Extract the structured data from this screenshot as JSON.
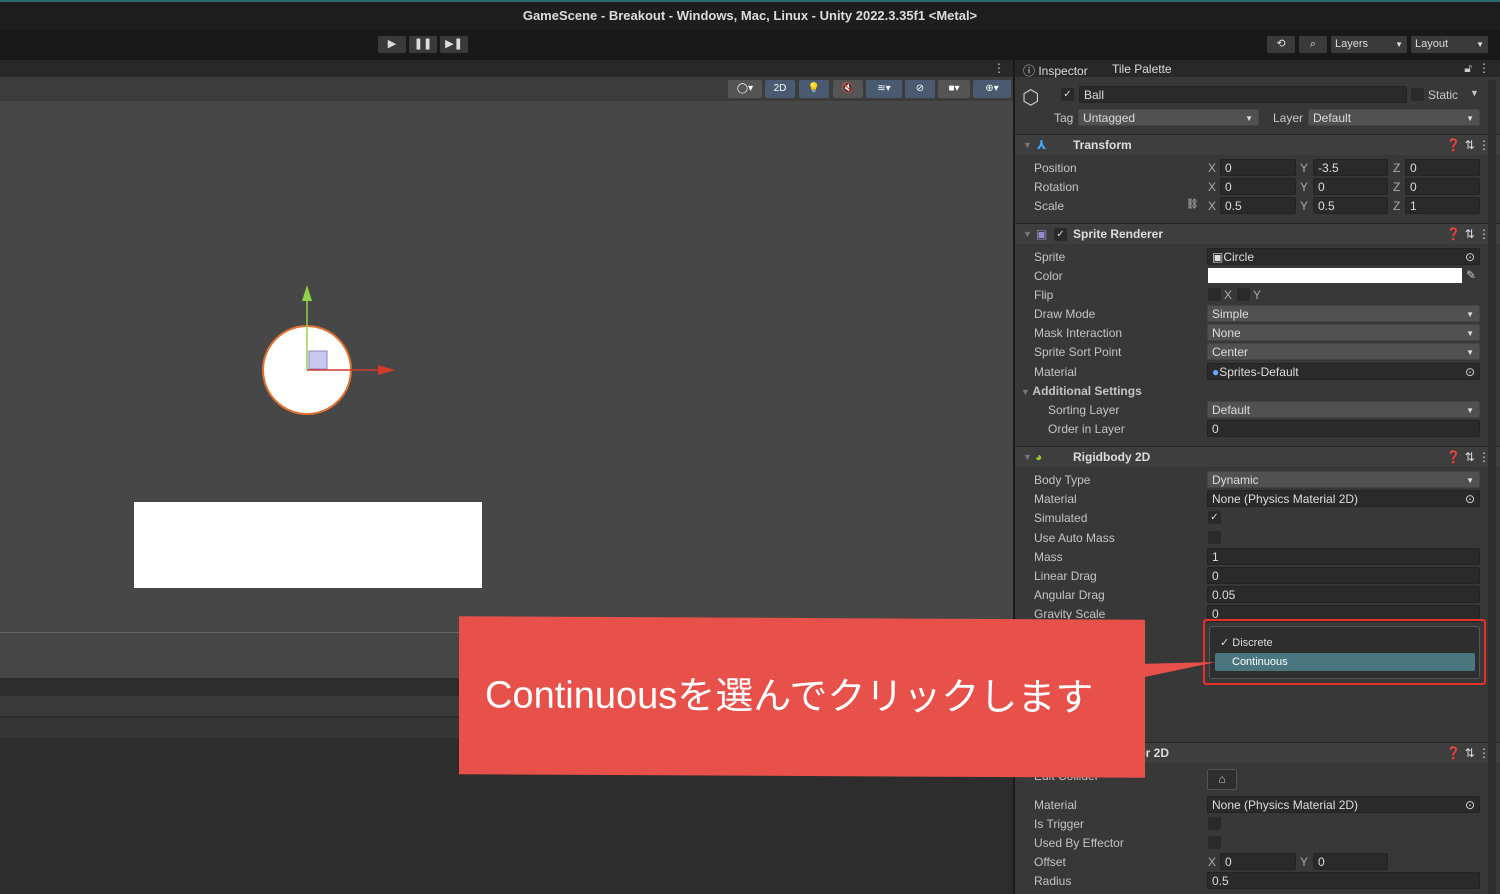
{
  "window": {
    "title": "GameScene - Breakout - Windows, Mac, Linux - Unity 2022.3.35f1 <Metal>"
  },
  "toolbar": {
    "play": "▶",
    "pause": "❚❚",
    "step": "▶❚",
    "layers": "Layers",
    "layout": "Layout"
  },
  "scene_tools": {
    "mode_2d": "2D"
  },
  "inspector": {
    "tabs": [
      "Inspector",
      "Tile Palette"
    ],
    "object_name": "Ball",
    "static_label": "Static",
    "tag_label": "Tag",
    "tag_value": "Untagged",
    "layer_label": "Layer",
    "layer_value": "Default",
    "transform": {
      "title": "Transform",
      "position": {
        "label": "Position",
        "x": "0",
        "y": "-3.5",
        "z": "0"
      },
      "rotation": {
        "label": "Rotation",
        "x": "0",
        "y": "0",
        "z": "0"
      },
      "scale": {
        "label": "Scale",
        "x": "0.5",
        "y": "0.5",
        "z": "1"
      }
    },
    "sprite_renderer": {
      "title": "Sprite Renderer",
      "rows": [
        {
          "label": "Sprite",
          "value": "Circle"
        },
        {
          "label": "Color",
          "value": ""
        },
        {
          "label": "Flip",
          "value": ""
        },
        {
          "label": "Draw Mode",
          "value": "Simple"
        },
        {
          "label": "Mask Interaction",
          "value": "None"
        },
        {
          "label": "Sprite Sort Point",
          "value": "Center"
        },
        {
          "label": "Material",
          "value": "Sprites-Default"
        }
      ],
      "additional_settings": "Additional Settings",
      "sorting_layer": {
        "label": "Sorting Layer",
        "value": "Default"
      },
      "order_in_layer": {
        "label": "Order in Layer",
        "value": "0"
      },
      "flip_x": "X",
      "flip_y": "Y"
    },
    "rigidbody": {
      "title": "Rigidbody 2D",
      "rows": [
        {
          "label": "Body Type",
          "value": "Dynamic"
        },
        {
          "label": "Material",
          "value": "None (Physics Material 2D)"
        },
        {
          "label": "Simulated",
          "value": "✓"
        },
        {
          "label": "Use Auto Mass",
          "value": ""
        },
        {
          "label": "Mass",
          "value": "1"
        },
        {
          "label": "Linear Drag",
          "value": "0"
        },
        {
          "label": "Angular Drag",
          "value": "0.05"
        },
        {
          "label": "Gravity Scale",
          "value": "0"
        }
      ]
    },
    "dropdown": {
      "options": [
        "✓ Discrete",
        "Continuous"
      ],
      "highlighted": "Continuous"
    },
    "collider": {
      "title_partial": "er 2D",
      "edit_label": "Edit Collider",
      "rows": [
        {
          "label": "Material",
          "value": "None (Physics Material 2D)"
        },
        {
          "label": "Is Trigger",
          "value": ""
        },
        {
          "label": "Used By Effector",
          "value": ""
        },
        {
          "label": "Offset",
          "x": "0",
          "y": "0"
        },
        {
          "label": "Radius",
          "value": "0.5"
        }
      ]
    }
  },
  "callout": {
    "text": "Continuousを選んでクリックします"
  },
  "colors": {
    "accent_red": "#e8504a",
    "highlight": "#4a7680"
  }
}
